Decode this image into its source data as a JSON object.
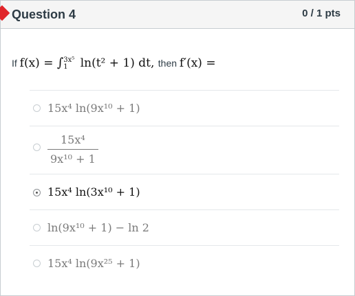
{
  "header": {
    "title": "Question 4",
    "points": "0 / 1 pts"
  },
  "question": {
    "prefix": "If",
    "middle": "then",
    "f_lhs": "f(x) =",
    "upper_limit": "3x⁵",
    "lower_limit": "1",
    "integrand": "ln(t² + 1) dt,",
    "fprime": "f′(x) ="
  },
  "answers": [
    {
      "text": "15x⁴ ln(9x¹⁰ + 1)",
      "selected": false
    },
    {
      "numerator": "15x⁴",
      "denominator": "9x¹⁰ + 1",
      "selected": false
    },
    {
      "text": "15x⁴ ln(3x¹⁰ + 1)",
      "selected": true
    },
    {
      "text": "ln(9x¹⁰ + 1) − ln 2",
      "selected": false
    },
    {
      "text": "15x⁴ ln(9x²⁵ + 1)",
      "selected": false
    }
  ],
  "colors": {
    "flag": "#e0252a",
    "header_bg": "#f5f5f5",
    "border": "#c7cdd1"
  }
}
